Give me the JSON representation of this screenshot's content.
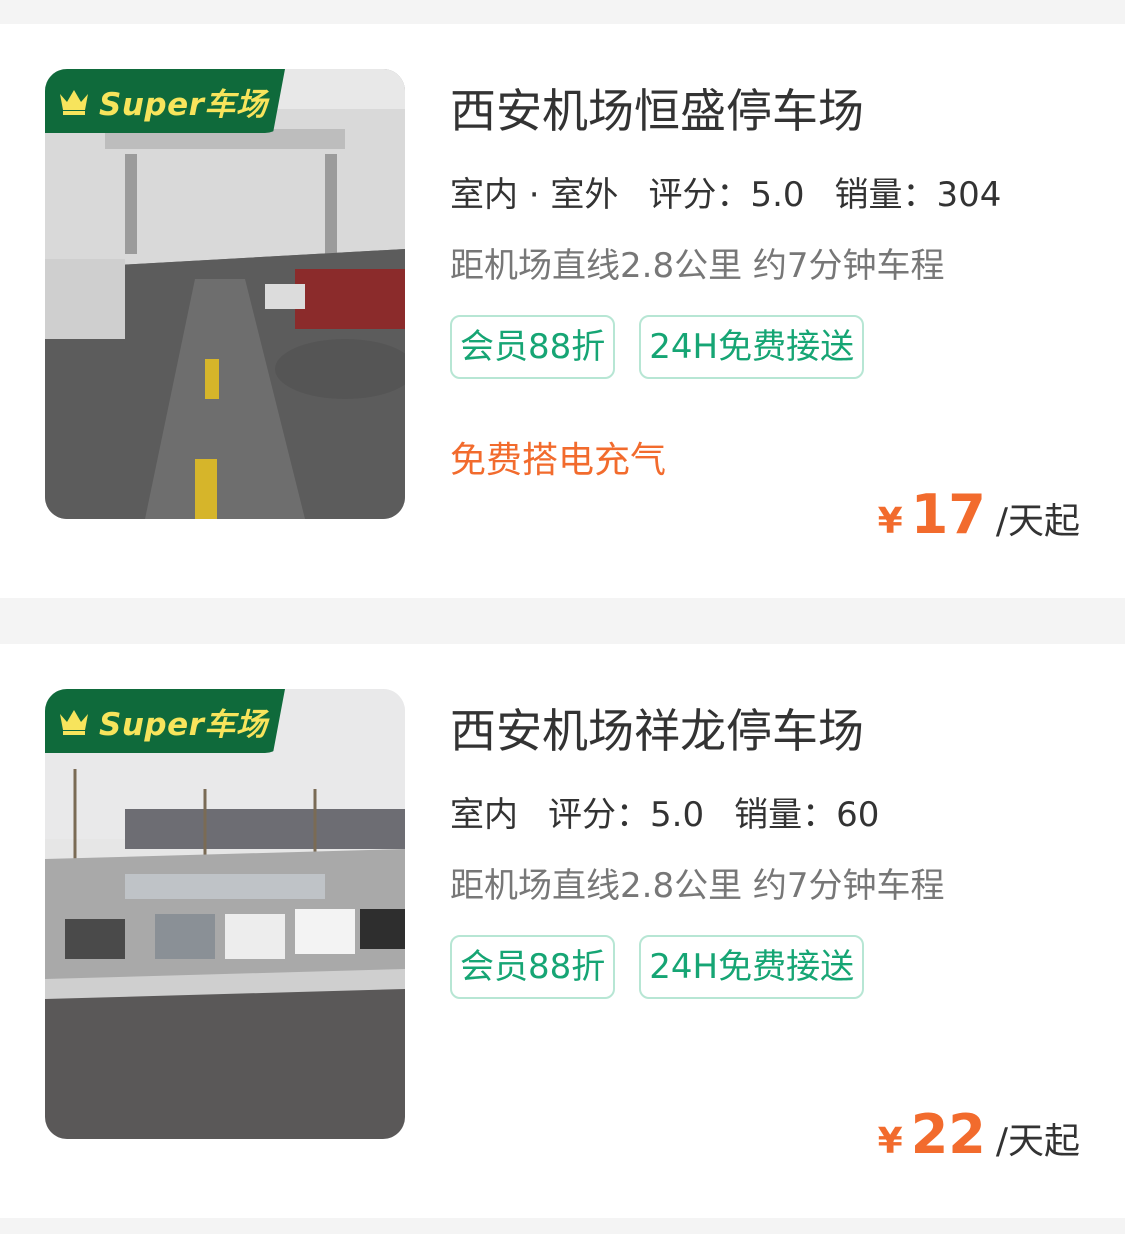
{
  "lots": [
    {
      "badge": "Super车场",
      "name": "西安机场恒盛停车场",
      "type": "室内 · 室外",
      "score_label": "评分：5.0",
      "sales_label": "销量：304",
      "distance": "距机场直线2.8公里 约7分钟车程",
      "chips": [
        "会员88折",
        "24H免费接送"
      ],
      "promo": "免费搭电充气",
      "price_symbol": "¥",
      "price": "17",
      "price_unit": "/天起"
    },
    {
      "badge": "Super车场",
      "name": "西安机场祥龙停车场",
      "type": "室内",
      "score_label": "评分：5.0",
      "sales_label": "销量：60",
      "distance": "距机场直线2.8公里 约7分钟车程",
      "chips": [
        "会员88折",
        "24H免费接送"
      ],
      "promo": "",
      "price_symbol": "¥",
      "price": "22",
      "price_unit": "/天起"
    }
  ],
  "colors": {
    "accent_green": "#16a574",
    "badge_green": "#0f6a3b",
    "price_orange": "#f26b2d"
  }
}
